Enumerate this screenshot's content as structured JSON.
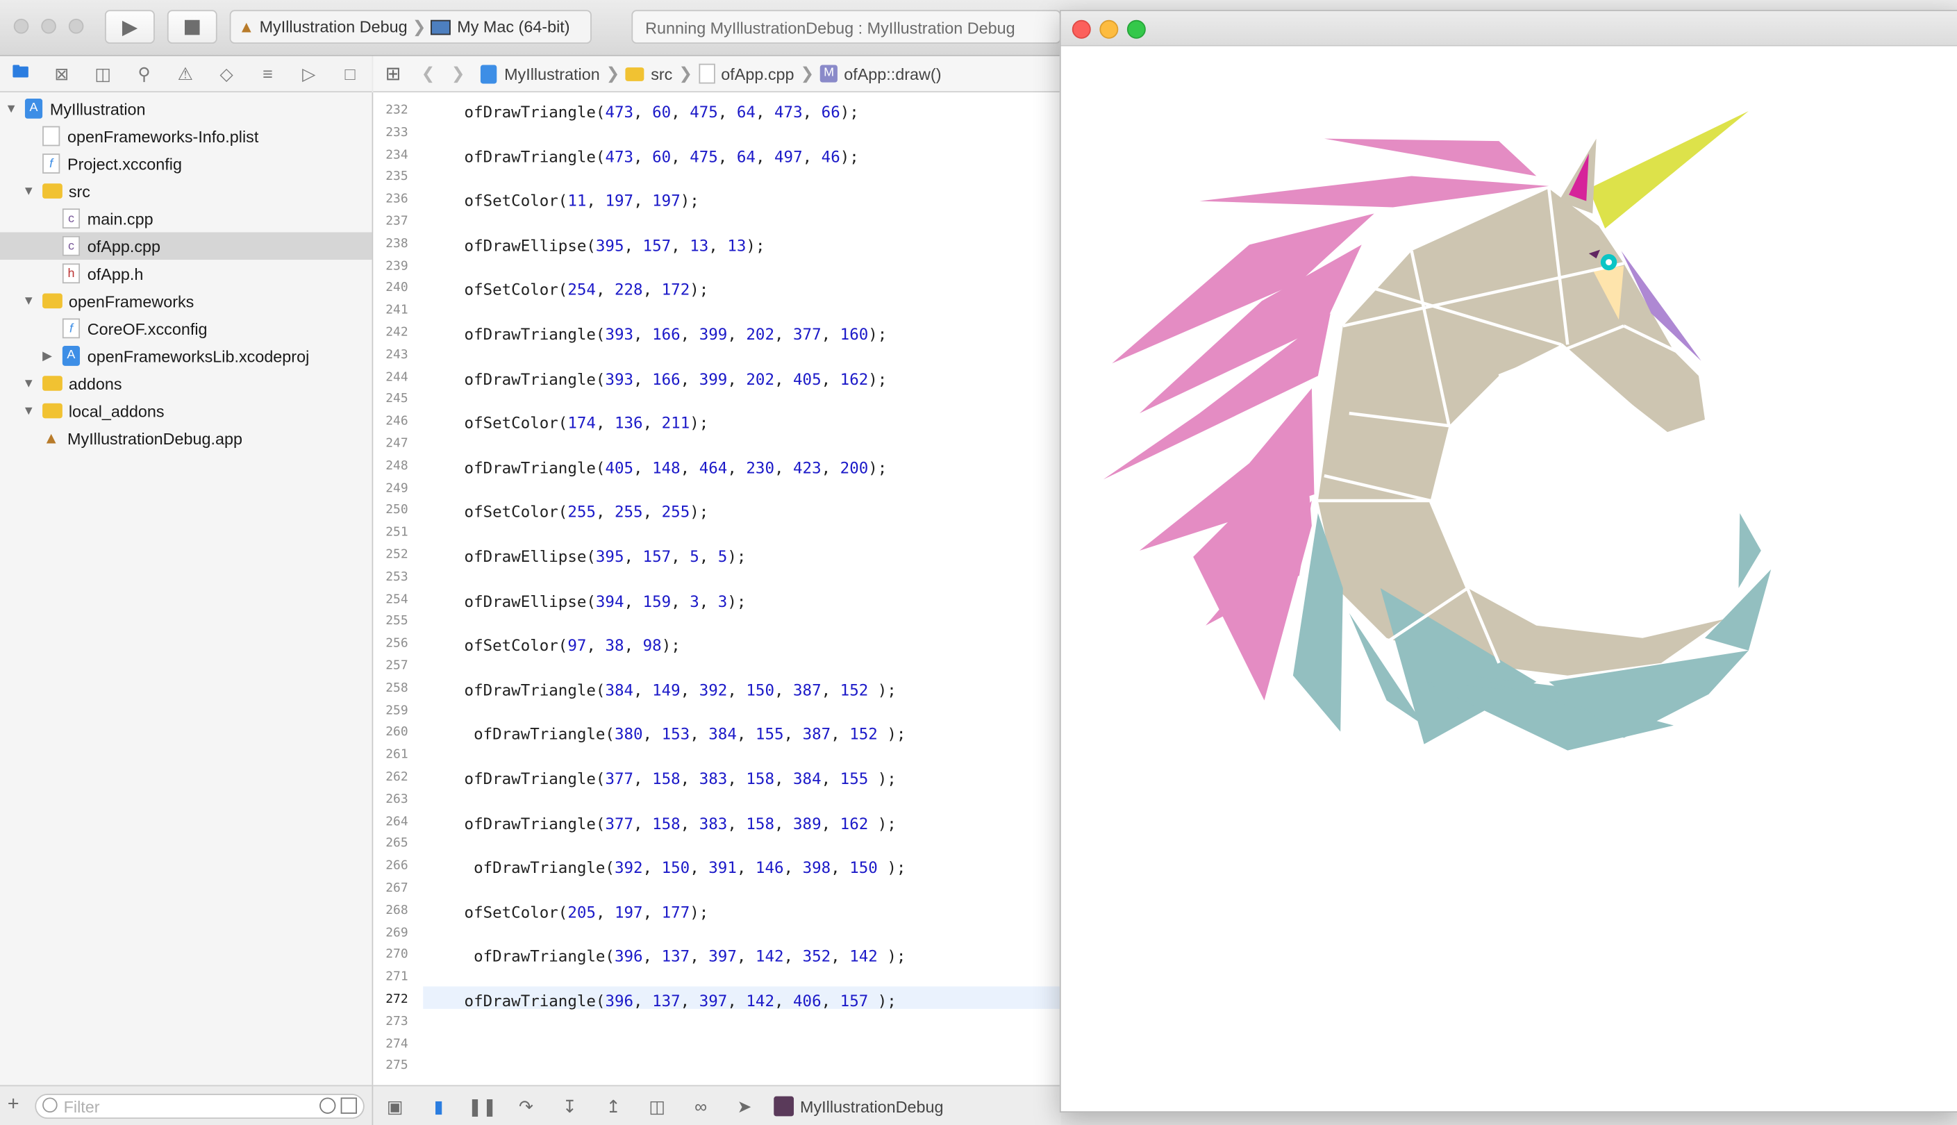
{
  "toolbar": {
    "scheme_target": "MyIllustration Debug",
    "scheme_device": "My Mac (64-bit)",
    "activity_status": "Running MyIllustrationDebug : MyIllustration Debug"
  },
  "navigator": {
    "items": [
      {
        "label": "MyIllustration"
      },
      {
        "label": "openFrameworks-Info.plist"
      },
      {
        "label": "Project.xcconfig"
      },
      {
        "label": "src"
      },
      {
        "label": "main.cpp"
      },
      {
        "label": "ofApp.cpp"
      },
      {
        "label": "ofApp.h"
      },
      {
        "label": "openFrameworks"
      },
      {
        "label": "CoreOF.xcconfig"
      },
      {
        "label": "openFrameworksLib.xcodeproj"
      },
      {
        "label": "addons"
      },
      {
        "label": "local_addons"
      },
      {
        "label": "MyIllustrationDebug.app"
      }
    ],
    "filter_placeholder": "Filter"
  },
  "jumpbar": {
    "project": "MyIllustration",
    "folder": "src",
    "file": "ofApp.cpp",
    "symbol": "ofApp::draw()"
  },
  "editor": {
    "current_line": "272",
    "lines": [
      {
        "num": "232",
        "code": "ofDrawTriangle(473, 60, 475, 64, 473, 66);"
      },
      {
        "num": "233",
        "code": ""
      },
      {
        "num": "234",
        "code": "ofDrawTriangle(473, 60, 475, 64, 497, 46);"
      },
      {
        "num": "235",
        "code": ""
      },
      {
        "num": "236",
        "code": "ofSetColor(11, 197, 197);"
      },
      {
        "num": "237",
        "code": ""
      },
      {
        "num": "238",
        "code": "ofDrawEllipse(395, 157, 13, 13);"
      },
      {
        "num": "239",
        "code": ""
      },
      {
        "num": "240",
        "code": "ofSetColor(254, 228, 172);"
      },
      {
        "num": "241",
        "code": ""
      },
      {
        "num": "242",
        "code": "ofDrawTriangle(393, 166, 399, 202, 377, 160);"
      },
      {
        "num": "243",
        "code": ""
      },
      {
        "num": "244",
        "code": "ofDrawTriangle(393, 166, 399, 202, 405, 162);"
      },
      {
        "num": "245",
        "code": ""
      },
      {
        "num": "246",
        "code": "ofSetColor(174, 136, 211);"
      },
      {
        "num": "247",
        "code": ""
      },
      {
        "num": "248",
        "code": "ofDrawTriangle(405, 148, 464, 230, 423, 200);"
      },
      {
        "num": "249",
        "code": ""
      },
      {
        "num": "250",
        "code": "ofSetColor(255, 255, 255);"
      },
      {
        "num": "251",
        "code": ""
      },
      {
        "num": "252",
        "code": "ofDrawEllipse(395, 157, 5, 5);"
      },
      {
        "num": "253",
        "code": ""
      },
      {
        "num": "254",
        "code": "ofDrawEllipse(394, 159, 3, 3);"
      },
      {
        "num": "255",
        "code": ""
      },
      {
        "num": "256",
        "code": "ofSetColor(97, 38, 98);"
      },
      {
        "num": "257",
        "code": ""
      },
      {
        "num": "258",
        "code": "ofDrawTriangle(384, 149, 392, 150, 387, 152 );"
      },
      {
        "num": "259",
        "code": ""
      },
      {
        "num": "260",
        "code": " ofDrawTriangle(380, 153, 384, 155, 387, 152 );"
      },
      {
        "num": "261",
        "code": ""
      },
      {
        "num": "262",
        "code": "ofDrawTriangle(377, 158, 383, 158, 384, 155 );"
      },
      {
        "num": "263",
        "code": ""
      },
      {
        "num": "264",
        "code": "ofDrawTriangle(377, 158, 383, 158, 389, 162 );"
      },
      {
        "num": "265",
        "code": ""
      },
      {
        "num": "266",
        "code": " ofDrawTriangle(392, 150, 391, 146, 398, 150 );"
      },
      {
        "num": "267",
        "code": ""
      },
      {
        "num": "268",
        "code": "ofSetColor(205, 197, 177);"
      },
      {
        "num": "269",
        "code": ""
      },
      {
        "num": "270",
        "code": " ofDrawTriangle(396, 137, 397, 142, 352, 142 );"
      },
      {
        "num": "271",
        "code": ""
      },
      {
        "num": "272",
        "code": "ofDrawTriangle(396, 137, 397, 142, 406, 157 );"
      },
      {
        "num": "273",
        "code": ""
      },
      {
        "num": "274",
        "code": ""
      },
      {
        "num": "275",
        "code": ""
      }
    ]
  },
  "debugbar": {
    "process_name": "MyIllustrationDebug"
  },
  "colors": {
    "pink": "#e48cc3",
    "beige": "#cdc5b1",
    "teal": "#93bfc0",
    "yellow": "#dde24a",
    "purple": "#ae88d3",
    "cyan": "#0bc5c5",
    "peach": "#fee4ac",
    "magenta": "#d6239a"
  }
}
